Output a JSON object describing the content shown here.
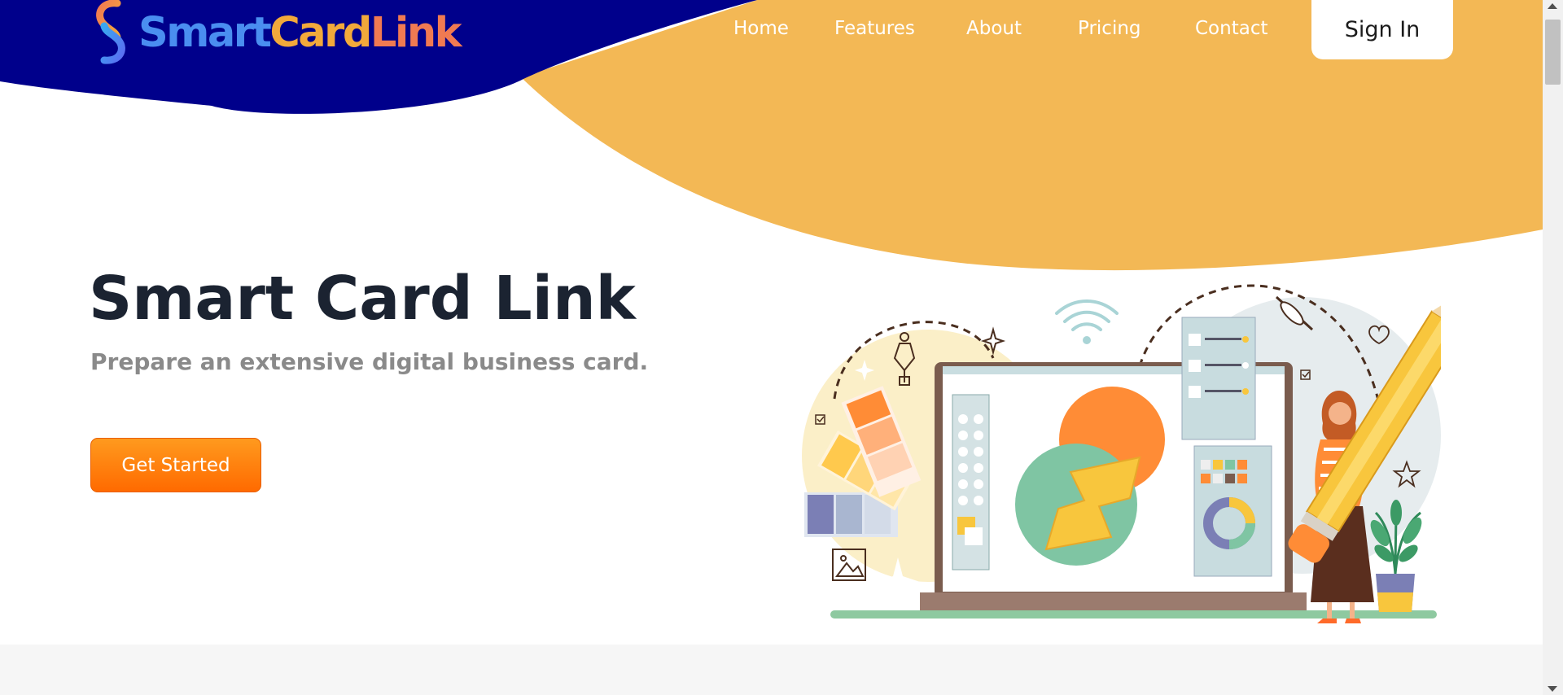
{
  "brand": {
    "word1": "Smart",
    "word2": "Card",
    "word3": "Link",
    "colors": {
      "word1": "#4a8ef0",
      "word2": "#f2a93b",
      "word3": "#f07a52"
    }
  },
  "nav": {
    "items": [
      {
        "label": "Home"
      },
      {
        "label": "Features"
      },
      {
        "label": "About"
      },
      {
        "label": "Pricing"
      },
      {
        "label": "Contact"
      }
    ],
    "sign_in": "Sign In"
  },
  "hero": {
    "title": "Smart Card Link",
    "subtitle": "Prepare an extensive digital business card.",
    "cta": "Get Started"
  },
  "theme": {
    "header_navy": "#00008b",
    "accent_orange": "#f3b855",
    "cta_orange": "#ff7a00",
    "title_color": "#1b2331",
    "subtitle_color": "#8a8a8a"
  },
  "icons": [
    "logo-link-icon",
    "wifi-icon",
    "heart-icon",
    "star-icon",
    "pen-tool-icon",
    "image-icon",
    "sparkle-icon",
    "checkbox-icon"
  ]
}
